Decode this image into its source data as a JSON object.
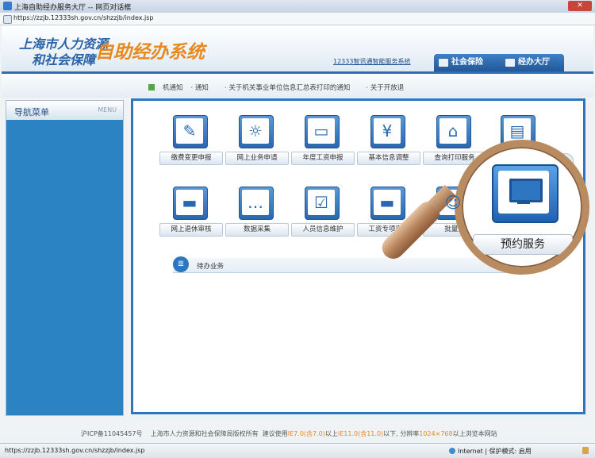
{
  "window": {
    "title": "上海自助经办服务大厅 -- 网页对话框",
    "close_label": "✕",
    "address": "https://zzjb.12333sh.gov.cn/shzzjb/index.jsp"
  },
  "header": {
    "logo_line1": "上海市人力资源",
    "logo_line2": "和社会保障",
    "logo_system": "自助经办系统",
    "service_link": "12333智讯通智能服务系统",
    "tabs": [
      {
        "label": "社会保险",
        "icon": "shield-icon"
      },
      {
        "label": "经办大厅",
        "icon": "building-icon"
      }
    ]
  },
  "notice_bar": {
    "items": [
      "机通知",
      "通知",
      "关于机关事业单位信息汇总表打印的通知",
      "关于开放退"
    ]
  },
  "sidebar": {
    "title": "导航菜单",
    "menu_label": "MENU"
  },
  "main": {
    "row1": [
      {
        "label": "缴费变更申报",
        "icon": "form-icon",
        "glyph": "✎"
      },
      {
        "label": "网上业务申请",
        "icon": "handshake-icon",
        "glyph": "☼"
      },
      {
        "label": "年度工资申报",
        "icon": "monitor-icon",
        "glyph": "▭"
      },
      {
        "label": "基本信息调整",
        "icon": "yen-icon",
        "glyph": "¥"
      },
      {
        "label": "查询打印服务",
        "icon": "home-icon",
        "glyph": "⌂"
      },
      {
        "label": "",
        "icon": "document-search-icon",
        "glyph": "▤"
      }
    ],
    "row2": [
      {
        "label": "网上退休审核",
        "icon": "printer-icon",
        "glyph": "▬"
      },
      {
        "label": "数据采集",
        "icon": "chat-icon",
        "glyph": "…"
      },
      {
        "label": "人员信息维护",
        "icon": "checklist-icon",
        "glyph": "☑"
      },
      {
        "label": "工资专项审核",
        "icon": "printer-icon",
        "glyph": "▬"
      },
      {
        "label": "批量变",
        "icon": "people-icon",
        "glyph": "☺"
      }
    ],
    "pending_label": "待办业务",
    "pending_glyph": "≣",
    "up_glyph": "∧"
  },
  "magnifier": {
    "label": "预约服务",
    "icon": "monitor-icon"
  },
  "footer": {
    "icp": "沪ICP备11045457号",
    "owner": "上海市人力资源和社会保障局版权所有",
    "advice_1": "建议使用",
    "ie7": "IE7.0(含7.0)",
    "advice_2": "以上",
    "ie11": "IE11.0(含11.0)",
    "advice_3": "以下, 分辨率",
    "resolution": "1024×768",
    "advice_4": "以上浏览本网站"
  },
  "statusbar": {
    "url": "https://zzjb.12333sh.gov.cn/shzzjb/index.jsp",
    "zone": "Internet",
    "protected_mode": "| 保护模式: 启用"
  }
}
